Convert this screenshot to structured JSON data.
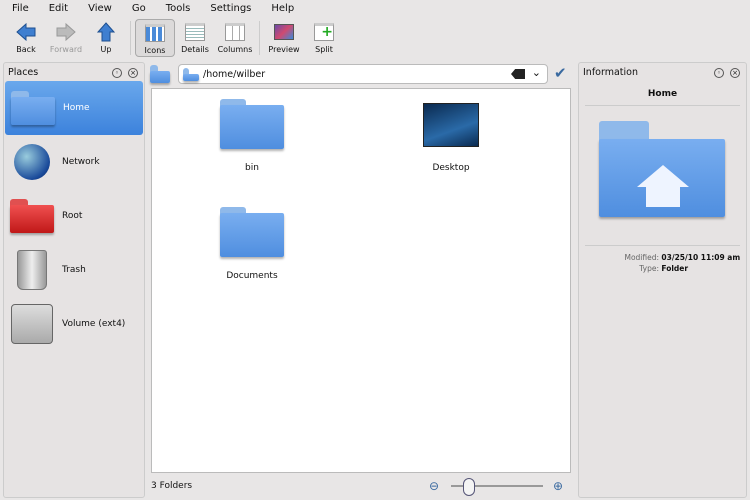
{
  "menubar": [
    "File",
    "Edit",
    "View",
    "Go",
    "Tools",
    "Settings",
    "Help"
  ],
  "toolbar": {
    "back": "Back",
    "forward": "Forward",
    "up": "Up",
    "icons": "Icons",
    "details": "Details",
    "columns": "Columns",
    "preview": "Preview",
    "split": "Split"
  },
  "places": {
    "title": "Places",
    "items": [
      "Home",
      "Network",
      "Root",
      "Trash",
      "Volume (ext4)"
    ]
  },
  "location": {
    "path": "/home/wilber"
  },
  "files": [
    "bin",
    "Desktop",
    "Documents"
  ],
  "status": {
    "text": "3 Folders",
    "zoom_level": 0.2
  },
  "info": {
    "title": "Information",
    "name": "Home",
    "modified_label": "Modified:",
    "modified": "03/25/10 11:09 am",
    "type_label": "Type:",
    "type": "Folder"
  }
}
